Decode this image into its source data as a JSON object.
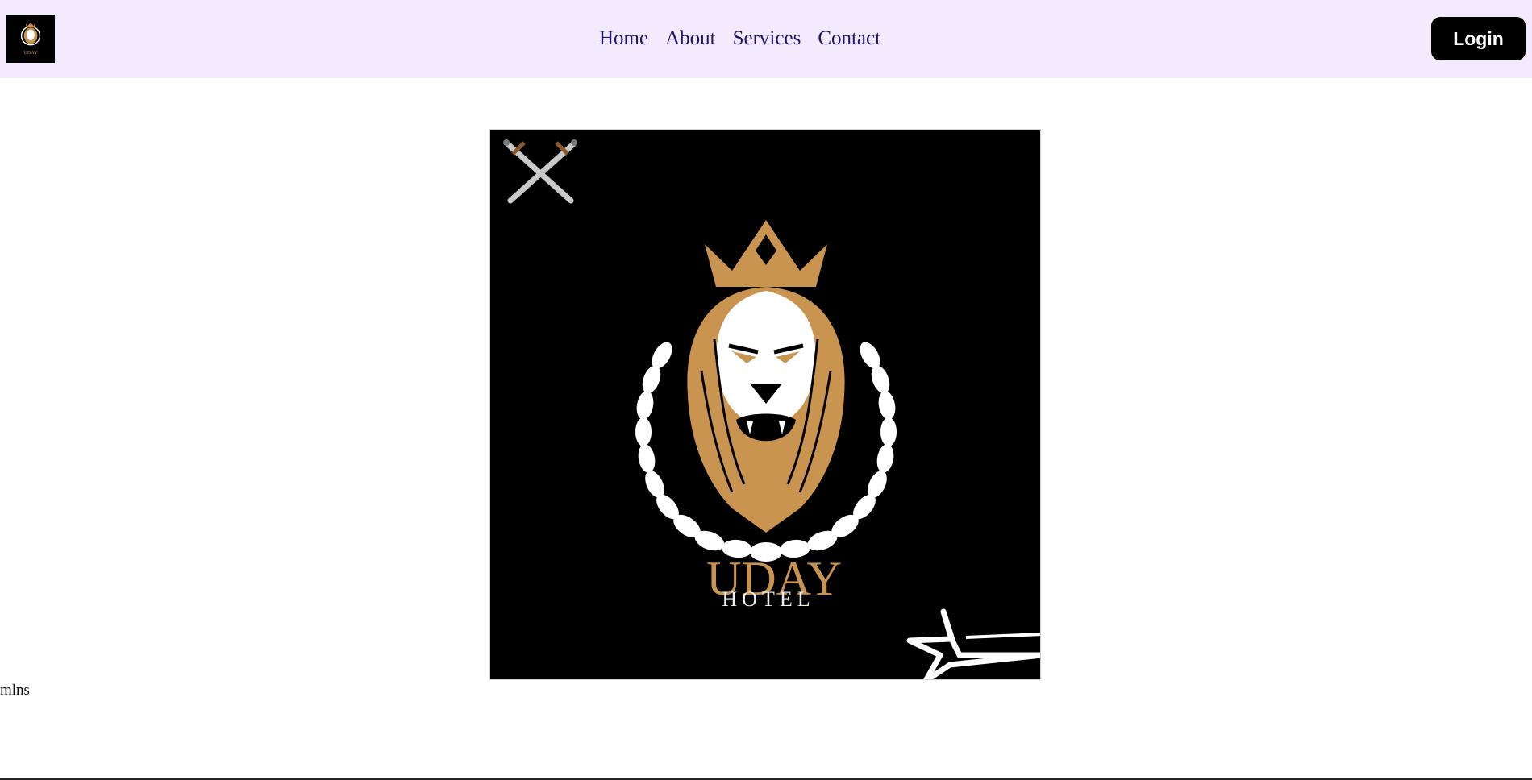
{
  "nav": {
    "logo_alt": "Uday Hotel logo",
    "links": [
      {
        "label": "Home"
      },
      {
        "label": "About"
      },
      {
        "label": "Services"
      },
      {
        "label": "Contact"
      }
    ],
    "login_label": "Login"
  },
  "hero": {
    "brand_name": "UDAY",
    "brand_subtitle": "HOTEL"
  },
  "stray_text": "mlns",
  "colors": {
    "navbar_bg": "#f3eafd",
    "nav_link": "#1c1470",
    "gold": "#c8944f",
    "logo_bg": "#000000"
  },
  "icons": [
    "crossed-swords-icon",
    "star-swoosh-icon",
    "lion-crest-icon"
  ]
}
